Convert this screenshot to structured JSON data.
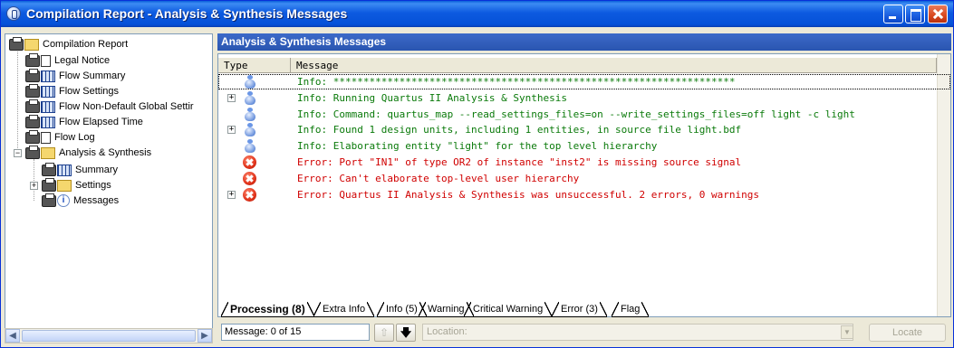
{
  "window": {
    "title": "Compilation Report - Analysis & Synthesis Messages"
  },
  "tree": {
    "items": [
      {
        "label": "Compilation Report",
        "icon": "report-folder-icon"
      },
      {
        "label": "Legal Notice",
        "icon": "document-icon"
      },
      {
        "label": "Flow Summary",
        "icon": "table-icon"
      },
      {
        "label": "Flow Settings",
        "icon": "table-icon"
      },
      {
        "label": "Flow Non-Default Global Settir",
        "icon": "table-icon"
      },
      {
        "label": "Flow Elapsed Time",
        "icon": "table-icon"
      },
      {
        "label": "Flow Log",
        "icon": "document-icon"
      },
      {
        "label": "Analysis & Synthesis",
        "icon": "folder-icon"
      },
      {
        "label": "Summary",
        "icon": "table-icon"
      },
      {
        "label": "Settings",
        "icon": "folder-icon"
      },
      {
        "label": "Messages",
        "icon": "info-icon"
      }
    ]
  },
  "panel": {
    "header": "Analysis & Synthesis Messages",
    "col_type": "Type",
    "col_message": "Message",
    "rows": [
      {
        "type": "info",
        "expand": false,
        "selected": true,
        "text": "Info: *******************************************************************",
        "color": "#0a7a0a"
      },
      {
        "type": "info",
        "expand": true,
        "selected": false,
        "text": "Info: Running Quartus II Analysis & Synthesis",
        "color": "#0a7a0a"
      },
      {
        "type": "info",
        "expand": false,
        "selected": false,
        "text": "Info: Command: quartus_map --read_settings_files=on --write_settings_files=off light -c light",
        "color": "#0a7a0a"
      },
      {
        "type": "info",
        "expand": true,
        "selected": false,
        "text": "Info: Found 1 design units, including 1 entities, in source file light.bdf",
        "color": "#0a7a0a"
      },
      {
        "type": "info",
        "expand": false,
        "selected": false,
        "text": "Info: Elaborating entity \"light\" for the top level hierarchy",
        "color": "#0a7a0a"
      },
      {
        "type": "error",
        "expand": false,
        "selected": false,
        "text": "Error: Port \"IN1\" of type OR2 of instance \"inst2\" is missing source signal",
        "color": "#d00000"
      },
      {
        "type": "error",
        "expand": false,
        "selected": false,
        "text": "Error: Can't elaborate top-level user hierarchy",
        "color": "#d00000"
      },
      {
        "type": "error",
        "expand": true,
        "selected": false,
        "text": "Error: Quartus II Analysis & Synthesis was unsuccessful. 2 errors, 0 warnings",
        "color": "#d00000"
      }
    ]
  },
  "tabs": [
    {
      "label": "Processing (8)",
      "active": true
    },
    {
      "label": "Extra Info",
      "active": false
    },
    {
      "label": "Info (5)",
      "active": false
    },
    {
      "label": "Warning",
      "active": false
    },
    {
      "label": "Critical Warning",
      "active": false
    },
    {
      "label": "Error (3)",
      "active": false
    },
    {
      "label": "Flag",
      "active": false
    }
  ],
  "status": {
    "message_count": "Message: 0 of 15",
    "location_placeholder": "Location:",
    "locate_label": "Locate"
  }
}
